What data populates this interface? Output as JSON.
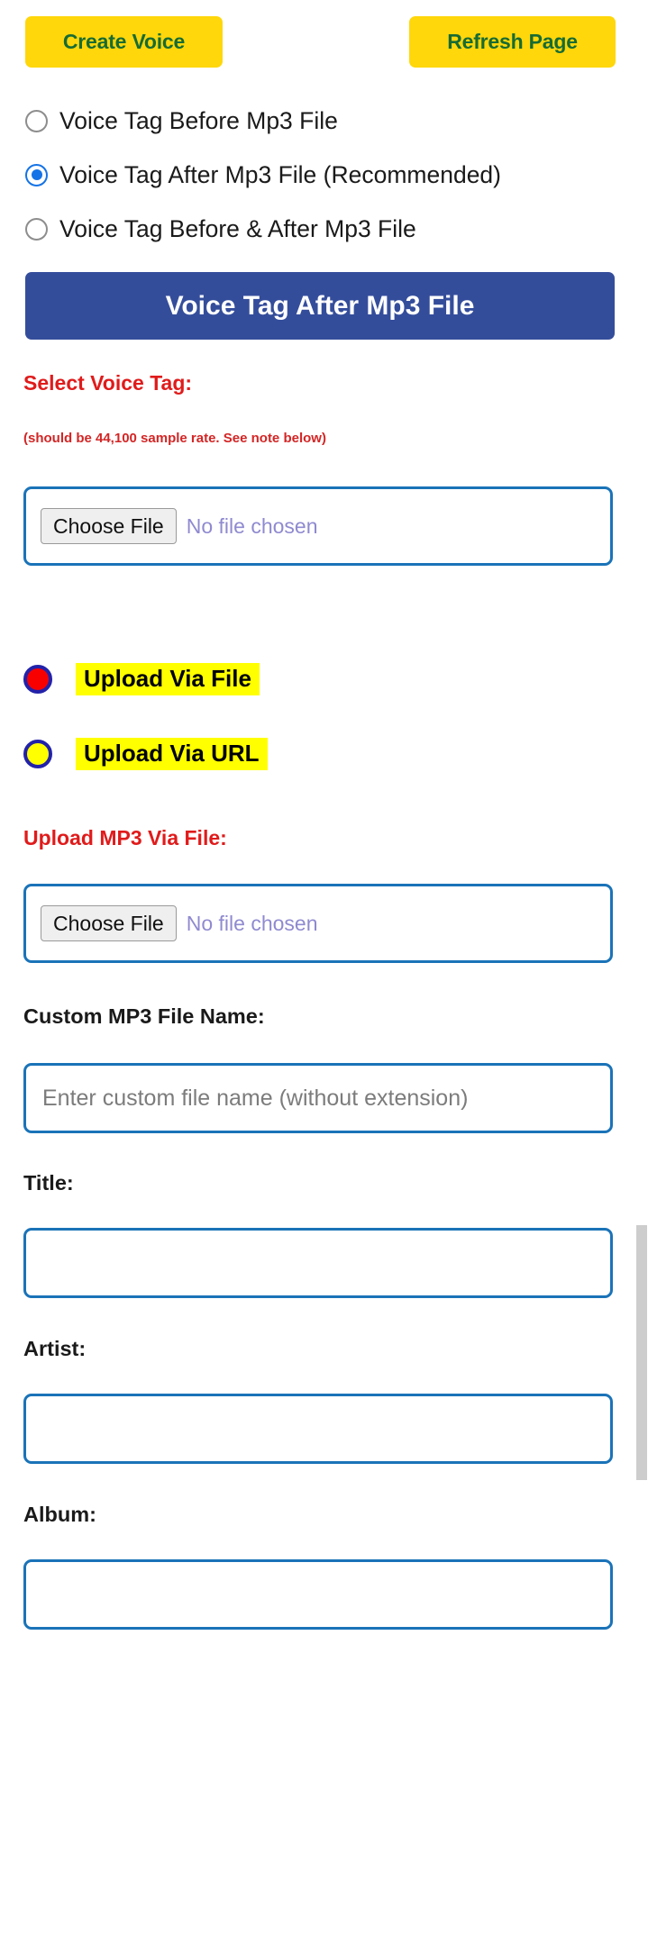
{
  "toolbar": {
    "create_voice_label": "Create Voice",
    "refresh_page_label": "Refresh Page"
  },
  "voice_tag_position": {
    "options": [
      {
        "label": "Voice Tag Before Mp3 File",
        "selected": false
      },
      {
        "label": "Voice Tag After Mp3 File (Recommended)",
        "selected": true
      },
      {
        "label": "Voice Tag Before & After Mp3 File",
        "selected": false
      }
    ]
  },
  "mode_banner": {
    "text": "Voice Tag After Mp3 File"
  },
  "voice_tag_section": {
    "label": "Select Voice Tag:",
    "note": "(should be 44,100 sample rate. See note below)",
    "file_input": {
      "button_label": "Choose File",
      "status_text": "No file chosen"
    }
  },
  "upload_source": {
    "options": [
      {
        "label": "Upload Via File",
        "selected": true
      },
      {
        "label": "Upload Via URL",
        "selected": false
      }
    ]
  },
  "mp3_section": {
    "label": "Upload MP3 Via File:",
    "file_input": {
      "button_label": "Choose File",
      "status_text": "No file chosen"
    }
  },
  "custom_name": {
    "label": "Custom MP3 File Name:",
    "placeholder": "Enter custom file name (without extension)",
    "value": ""
  },
  "metadata": {
    "title": {
      "label": "Title:",
      "value": "",
      "placeholder": ""
    },
    "artist": {
      "label": "Artist:",
      "value": "",
      "placeholder": ""
    },
    "album": {
      "label": "Album:",
      "value": "",
      "placeholder": ""
    }
  },
  "colors": {
    "accent_yellow": "#ffd70a",
    "button_text_green": "#176b33",
    "banner_blue": "#344d9b",
    "label_red": "#e01b1b",
    "input_border_blue": "#1a73b8",
    "radio_selected_red": "#f80000",
    "radio_unselected_yellow": "#ffff00",
    "radio_border_blue": "#2222aa",
    "highlight_yellow": "#ffff00",
    "scrollbar_thumb": "#cdcdcd"
  }
}
